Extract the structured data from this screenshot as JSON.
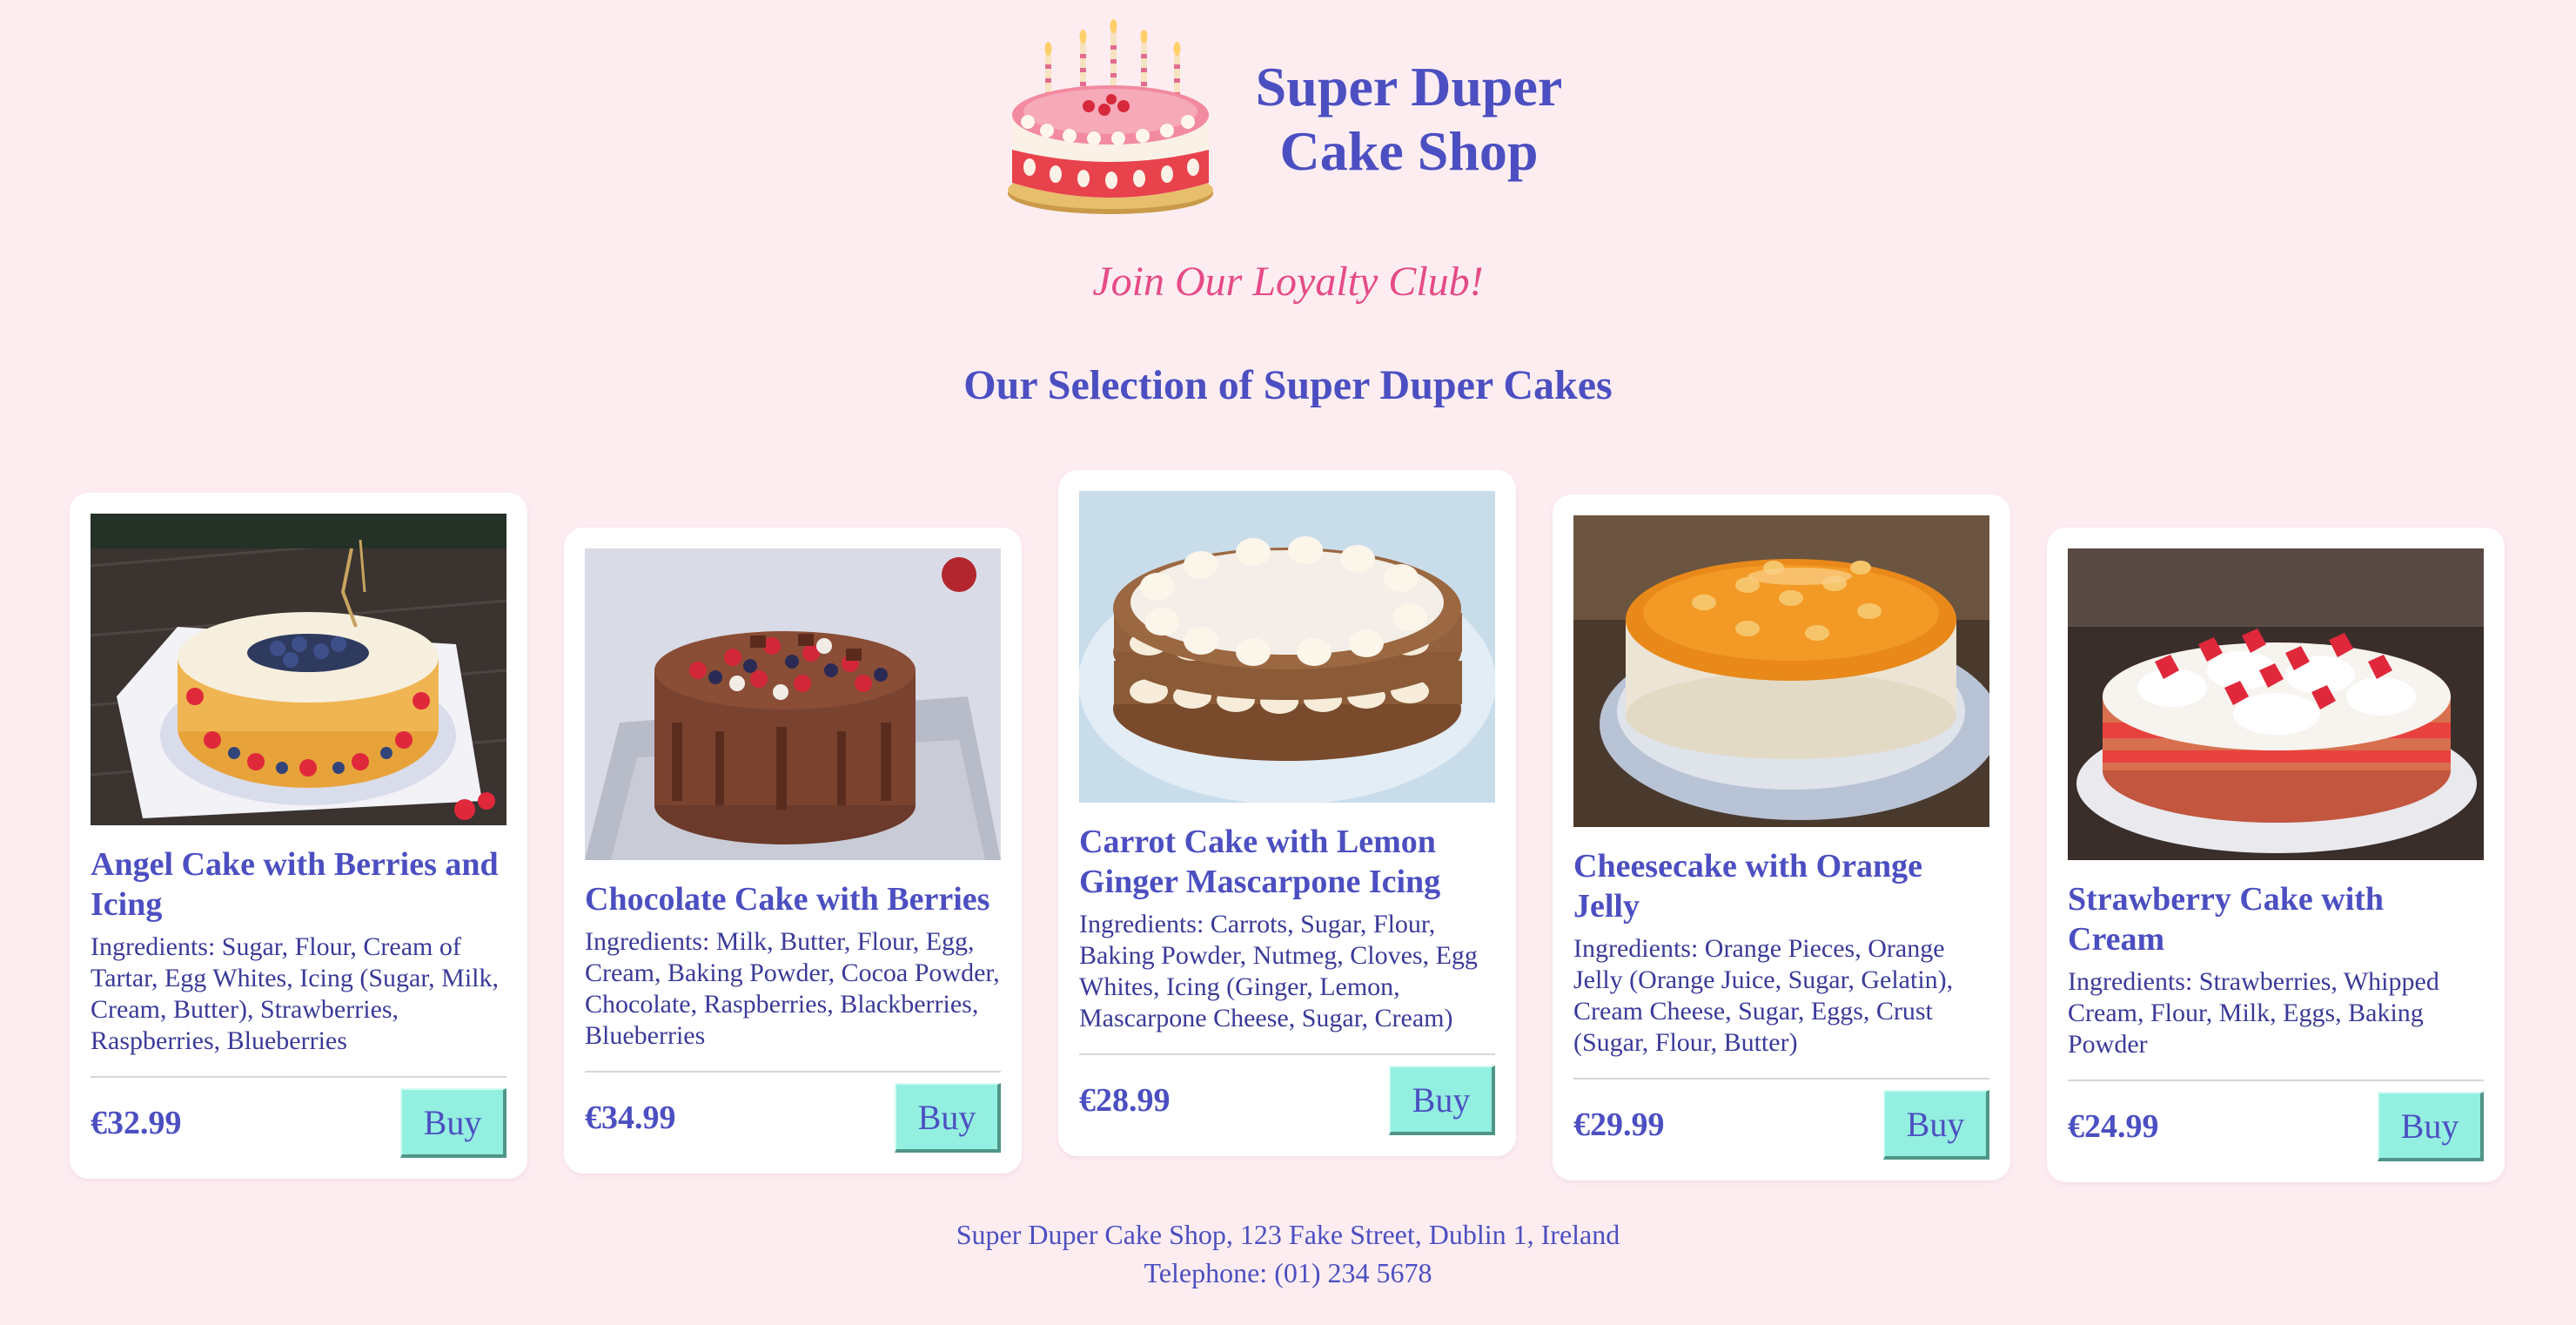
{
  "header": {
    "logo_icon": "birthday-cake-icon",
    "title_line1": "Super Duper",
    "title_line2": "Cake Shop"
  },
  "loyalty_link": "Join Our Loyalty Club!",
  "section_title": "Our Selection of Super Duper Cakes",
  "products": [
    {
      "name": "Angel Cake with Berries and Icing",
      "ingredients": "Ingredients: Sugar, Flour, Cream of Tartar, Egg Whites, Icing (Sugar, Milk, Cream, Butter), Strawberries, Raspberries, Blueberries",
      "price": "€32.99",
      "buy_label": "Buy"
    },
    {
      "name": "Chocolate Cake with Berries",
      "ingredients": "Ingredients: Milk, Butter, Flour, Egg, Cream, Baking Powder, Cocoa Powder, Chocolate, Raspberries, Blackberries, Blueberries",
      "price": "€34.99",
      "buy_label": "Buy"
    },
    {
      "name": "Carrot Cake with Lemon Ginger Mascarpone Icing",
      "ingredients": "Ingredients: Carrots, Sugar, Flour, Baking Powder, Nutmeg, Cloves, Egg Whites, Icing (Ginger, Lemon, Mascarpone Cheese, Sugar, Cream)",
      "price": "€28.99",
      "buy_label": "Buy"
    },
    {
      "name": "Cheesecake with Orange Jelly",
      "ingredients": "Ingredients: Orange Pieces, Orange Jelly (Orange Juice, Sugar, Gelatin), Cream Cheese, Sugar, Eggs, Crust (Sugar, Flour, Butter)",
      "price": "€29.99",
      "buy_label": "Buy"
    },
    {
      "name": "Strawberry Cake with Cream",
      "ingredients": "Ingredients: Strawberries, Whipped Cream, Flour, Milk, Eggs, Baking Powder",
      "price": "€24.99",
      "buy_label": "Buy"
    }
  ],
  "footer": {
    "address": "Super Duper Cake Shop, 123 Fake Street, Dublin 1, Ireland",
    "telephone": "Telephone: (01) 234 5678"
  },
  "colors": {
    "background": "#fdedf1",
    "brand_text": "#4c4fc1",
    "loyalty_pink": "#e54b86",
    "buy_button": "#93efe0"
  }
}
